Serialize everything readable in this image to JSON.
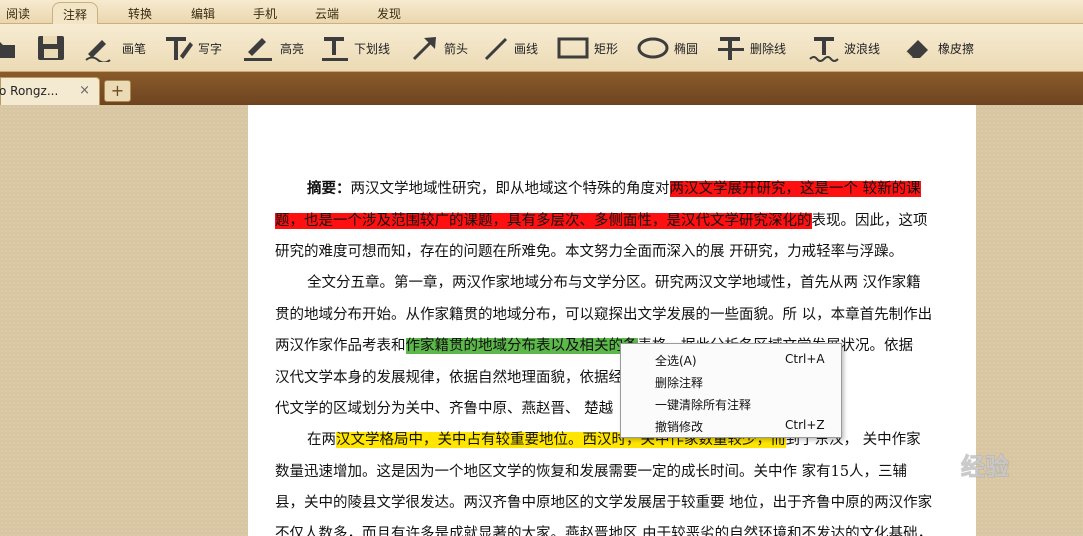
{
  "menu": {
    "tabs": [
      {
        "label": "阅读",
        "active": false
      },
      {
        "label": "注释",
        "active": true
      },
      {
        "label": "转换",
        "active": false
      },
      {
        "label": "编辑",
        "active": false
      },
      {
        "label": "手机",
        "active": false
      },
      {
        "label": "云端",
        "active": false
      },
      {
        "label": "发现",
        "active": false
      }
    ]
  },
  "toolbar": {
    "tools": [
      {
        "label": "画笔",
        "icon": "pen-icon"
      },
      {
        "label": "写字",
        "icon": "text-write-icon"
      },
      {
        "label": "高亮",
        "icon": "highlight-icon"
      },
      {
        "label": "下划线",
        "icon": "underline-icon"
      },
      {
        "label": "箭头",
        "icon": "arrow-icon"
      },
      {
        "label": "画线",
        "icon": "line-icon"
      },
      {
        "label": "矩形",
        "icon": "rectangle-icon"
      },
      {
        "label": "椭圆",
        "icon": "ellipse-icon"
      },
      {
        "label": "删除线",
        "icon": "strikethrough-icon"
      },
      {
        "label": "波浪线",
        "icon": "wavy-line-icon"
      },
      {
        "label": "橡皮擦",
        "icon": "eraser-icon"
      }
    ]
  },
  "tabs": {
    "doc_title": "o Rongz...",
    "close_glyph": "×",
    "add_glyph": "+"
  },
  "document": {
    "l1_bold": "摘要：",
    "l1_text": "两汉文学地域性研究，即从地域这个特殊的角度对",
    "l1_hl": "两汉文学展开研究，这是一个 较新的课",
    "l2_hl": "题，也是一个涉及范围较广的课题，具有多层次、多侧面性，是汉代文学研究深化的",
    "l2_text": "表现。因此，这项",
    "l3": "研究的难度可想而知，存在的问题在所难免。本文努力全面而深入的展 开研究，力戒轻率与浮躁。",
    "l4": "全文分五章。第一章，两汉作家地域分布与文学分区。研究两汉文学地域性，首先从两 汉作家籍",
    "l5": "贯的地域分布开始。从作家籍贯的地域分布，可以窥探出文学发展的一些面貌。所 以，本章首先制作出",
    "l6_text": "两汉作家作品考表和",
    "l6_hl": "作家籍贯的地域分布表以及相关的条",
    "l6_rest": "表格，据此分析各区域文学发展状况。依据",
    "l7": "汉代文学本身的发展规律，依据自然地理面貌，依据经济、政治、文化的基础，我们把汉",
    "l8": "代文学的区域划分为关中、齐鲁中原、燕赵晋、 楚越",
    "l9_text": "在两",
    "l9_hl": "汉文学格局中，关中占有较重要地位。西汉时，关中作家数量较少，而",
    "l9_rest": "到了东汉， 关中作家",
    "l10": "数量迅速增加。这是因为一个地区文学的恢复和发展需要一定的成长时间。关中作 家有15人，三辅",
    "l11": "县，关中的陵县文学很发达。两汉齐鲁中原地区的文学发展居于较重要 地位，出于齐鲁中原的两汉作家",
    "l12": "不仅人数多，而且有许多是成就显著的大家。燕赵晋地区 由于较恶劣的自然环境和不发达的文化基础，"
  },
  "context_menu": {
    "items": [
      {
        "label": "全选(A)",
        "shortcut": "Ctrl+A"
      },
      {
        "label": "删除注释",
        "shortcut": ""
      },
      {
        "label": "一键清除所有注释",
        "shortcut": ""
      },
      {
        "label": "撤销修改",
        "shortcut": "Ctrl+Z"
      }
    ]
  },
  "watermark": {
    "text": "经验"
  },
  "colors": {
    "highlight_red": "#ff1010",
    "highlight_green": "#5cb84a",
    "highlight_yellow": "#ffe500",
    "toolbar_bg": "#f3e6c6",
    "tabstrip_bg": "#7a4c24"
  }
}
